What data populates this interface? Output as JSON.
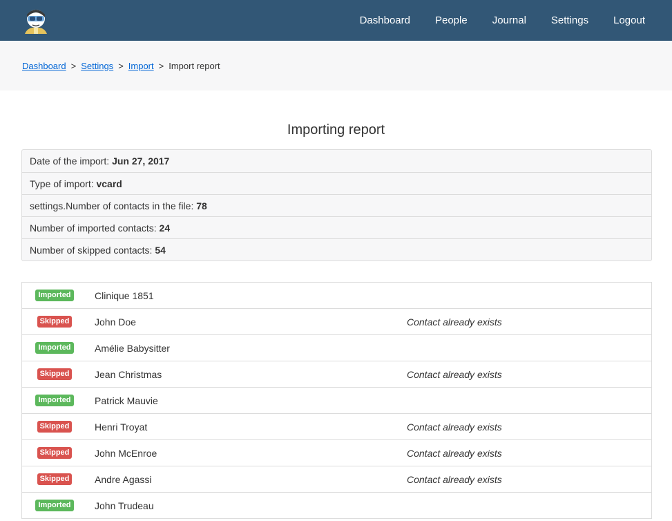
{
  "colors": {
    "header_bg": "#325776",
    "imported": "#5cb85c",
    "skipped": "#d9534f",
    "link": "#0366d6"
  },
  "header": {
    "logo": "monica-logo-icon",
    "nav": [
      "Dashboard",
      "People",
      "Journal",
      "Settings",
      "Logout"
    ]
  },
  "breadcrumb": {
    "links": [
      "Dashboard",
      "Settings",
      "Import"
    ],
    "separator": ">",
    "current": "Import report"
  },
  "page_title": "Importing report",
  "info": [
    {
      "label": "Date of the import: ",
      "value": "Jun 27, 2017"
    },
    {
      "label": "Type of import: ",
      "value": "vcard"
    },
    {
      "label": "settings.Number of contacts in the file: ",
      "value": "78"
    },
    {
      "label": "Number of imported contacts: ",
      "value": "24"
    },
    {
      "label": "Number of skipped contacts: ",
      "value": "54"
    }
  ],
  "contacts": [
    {
      "status": "Imported",
      "name": "Clinique 1851",
      "reason": ""
    },
    {
      "status": "Skipped",
      "name": "John Doe",
      "reason": "Contact already exists"
    },
    {
      "status": "Imported",
      "name": "Amélie Babysitter",
      "reason": ""
    },
    {
      "status": "Skipped",
      "name": "Jean Christmas",
      "reason": "Contact already exists"
    },
    {
      "status": "Imported",
      "name": "Patrick Mauvie",
      "reason": ""
    },
    {
      "status": "Skipped",
      "name": "Henri Troyat",
      "reason": "Contact already exists"
    },
    {
      "status": "Skipped",
      "name": "John McEnroe",
      "reason": "Contact already exists"
    },
    {
      "status": "Skipped",
      "name": "Andre Agassi",
      "reason": "Contact already exists"
    },
    {
      "status": "Imported",
      "name": "John Trudeau",
      "reason": ""
    }
  ]
}
